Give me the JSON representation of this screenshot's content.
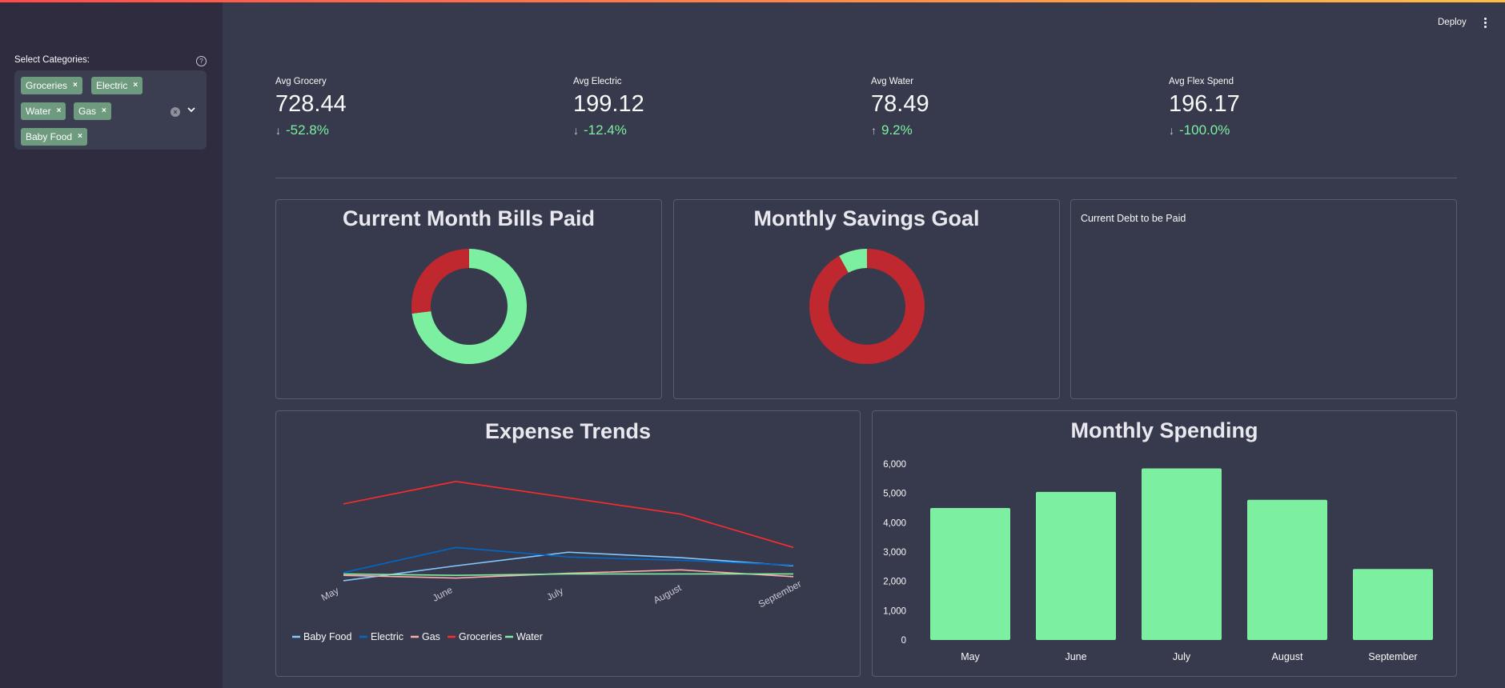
{
  "sidebar": {
    "select_label": "Select Categories:",
    "tags": [
      "Groceries",
      "Electric",
      "Water",
      "Gas",
      "Baby Food"
    ],
    "remove_glyph": "×",
    "clear_glyph": "×"
  },
  "header": {
    "deploy_label": "Deploy"
  },
  "metrics": [
    {
      "label": "Avg Grocery",
      "value": "728.44",
      "delta": "-52.8%",
      "direction": "down"
    },
    {
      "label": "Avg Electric",
      "value": "199.12",
      "delta": "-12.4%",
      "direction": "down"
    },
    {
      "label": "Avg Water",
      "value": "78.49",
      "delta": "9.2%",
      "direction": "up"
    },
    {
      "label": "Avg Flex Spend",
      "value": "196.17",
      "delta": "-100.0%",
      "direction": "down"
    }
  ],
  "arrows": {
    "down": "↓",
    "up": "↑"
  },
  "cards": {
    "bills_title": "Current Month Bills Paid",
    "savings_title": "Monthly Savings Goal",
    "debt_title": "Current Debt to be Paid",
    "trends_title": "Expense Trends",
    "spending_title": "Monthly Spending"
  },
  "colors": {
    "green": "#7defa1",
    "red": "#c0282f",
    "baby_food": "#83c9ff",
    "electric": "#0068c9",
    "gas": "#ffabab",
    "groceries": "#ff2b2b",
    "water": "#7defa1"
  },
  "chart_data": [
    {
      "type": "pie",
      "title": "Current Month Bills Paid",
      "slices": [
        {
          "value": 73,
          "color": "#7defa1"
        },
        {
          "value": 27,
          "color": "#c0282f"
        }
      ]
    },
    {
      "type": "pie",
      "title": "Monthly Savings Goal",
      "slices": [
        {
          "value": 92,
          "color": "#c0282f"
        },
        {
          "value": 8,
          "color": "#7defa1"
        }
      ]
    },
    {
      "type": "line",
      "title": "Expense Trends",
      "categories": [
        "May",
        "June",
        "July",
        "August",
        "September"
      ],
      "ylim": [
        0,
        1600
      ],
      "series": [
        {
          "name": "Baby Food",
          "color": "#83c9ff",
          "values": [
            -70,
            150,
            350,
            270,
            150
          ]
        },
        {
          "name": "Electric",
          "color": "#0068c9",
          "values": [
            50,
            420,
            280,
            230,
            160
          ]
        },
        {
          "name": "Gas",
          "color": "#ffabab",
          "values": [
            10,
            -30,
            40,
            90,
            -10
          ]
        },
        {
          "name": "Groceries",
          "color": "#ff2b2b",
          "values": [
            1060,
            1390,
            1150,
            910,
            420
          ]
        },
        {
          "name": "Water",
          "color": "#7defa1",
          "values": [
            30,
            10,
            30,
            30,
            30
          ]
        }
      ]
    },
    {
      "type": "bar",
      "title": "Monthly Spending",
      "categories": [
        "May",
        "June",
        "July",
        "August",
        "September"
      ],
      "values": [
        4500,
        5050,
        5850,
        4780,
        2420
      ],
      "ylim": [
        0,
        6000
      ],
      "yticks": [
        "0",
        "1,000",
        "2,000",
        "3,000",
        "4,000",
        "5,000",
        "6,000"
      ],
      "color": "#7defa1"
    }
  ]
}
